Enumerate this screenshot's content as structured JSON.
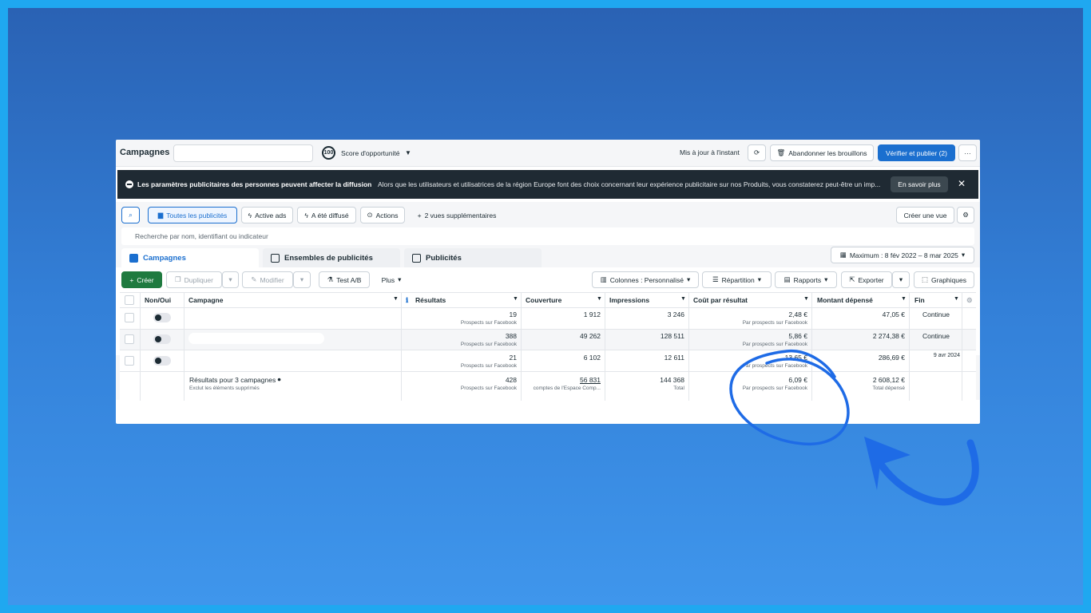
{
  "header": {
    "title": "Campagnes",
    "score_value": "100",
    "score_label": "Score d'opportunité",
    "saved_status": "Mis à jour à l'instant",
    "discard_label": "Abandonner les brouillons",
    "publish_label": "Vérifier et publier (2)",
    "more_label": "···"
  },
  "banner": {
    "title": "Les paramètres publicitaires des personnes peuvent affecter la diffusion",
    "text": "Alors que les utilisateurs et utilisatrices de la région Europe font des choix concernant leur expérience publicitaire sur nos Produits, vous constaterez peut-être un imp...",
    "learn_more": "En savoir plus",
    "close": "✕"
  },
  "filters": {
    "all_ads": "Toutes les publicités",
    "active_ads": "Active ads",
    "delivered": "A été diffusé",
    "actions": "Actions",
    "more_views": "2 vues supplémentaires",
    "create_view": "Créer une vue",
    "search_placeholder": "Recherche par nom, identifiant ou indicateur"
  },
  "tabs": {
    "campaigns": "Campagnes",
    "adsets": "Ensembles de publicités",
    "ads": "Publicités",
    "date_range": "Maximum : 8 fév 2022 – 8 mar 2025"
  },
  "toolbar": {
    "create": "Créer",
    "duplicate": "Dupliquer",
    "edit": "Modifier",
    "ab_test": "Test A/B",
    "more": "Plus",
    "columns": "Colonnes : Personnalisé",
    "breakdown": "Répartition",
    "reports": "Rapports",
    "export": "Exporter",
    "charts": "Graphiques"
  },
  "table": {
    "headers": {
      "onoff": "Non/Oui",
      "campaign": "Campagne",
      "results": "Résultats",
      "reach": "Couverture",
      "impressions": "Impressions",
      "cost": "Coût par résultat",
      "spent": "Montant dépensé",
      "end": "Fin"
    },
    "rows": [
      {
        "results": "19",
        "results_sub": "Prospects sur Facebook",
        "reach": "1 912",
        "impressions": "3 246",
        "cost": "2,48 €",
        "cost_sub": "Par prospects sur Facebook",
        "spent": "47,05 €",
        "end": "Continue"
      },
      {
        "results": "388",
        "results_sub": "Prospects sur Facebook",
        "reach": "49 262",
        "impressions": "128 511",
        "cost": "5,86 €",
        "cost_sub": "Par prospects sur Facebook",
        "spent": "2 274,38 €",
        "end": "Continue"
      },
      {
        "results": "21",
        "results_sub": "Prospects sur Facebook",
        "reach": "6 102",
        "impressions": "12 611",
        "cost": "13,65 €",
        "cost_sub": "Par prospects sur Facebook",
        "spent": "286,69 €",
        "end": "9 avr 2024"
      }
    ],
    "totals": {
      "label": "Résultats pour 3 campagnes",
      "sublabel": "Exclut les éléments supprimés",
      "results": "428",
      "results_sub": "Prospects sur Facebook",
      "reach": "56 831",
      "reach_sub": "comptes de l'Espace Comp...",
      "impressions": "144 368",
      "impressions_sub": "Total",
      "cost": "6,09 €",
      "cost_sub": "Par prospects sur Facebook",
      "spent": "2 608,12 €",
      "spent_sub": "Total dépensé"
    }
  },
  "colors": {
    "accent": "#1b6fcf",
    "create": "#1f7a3f",
    "annotation": "#1e6be6"
  }
}
